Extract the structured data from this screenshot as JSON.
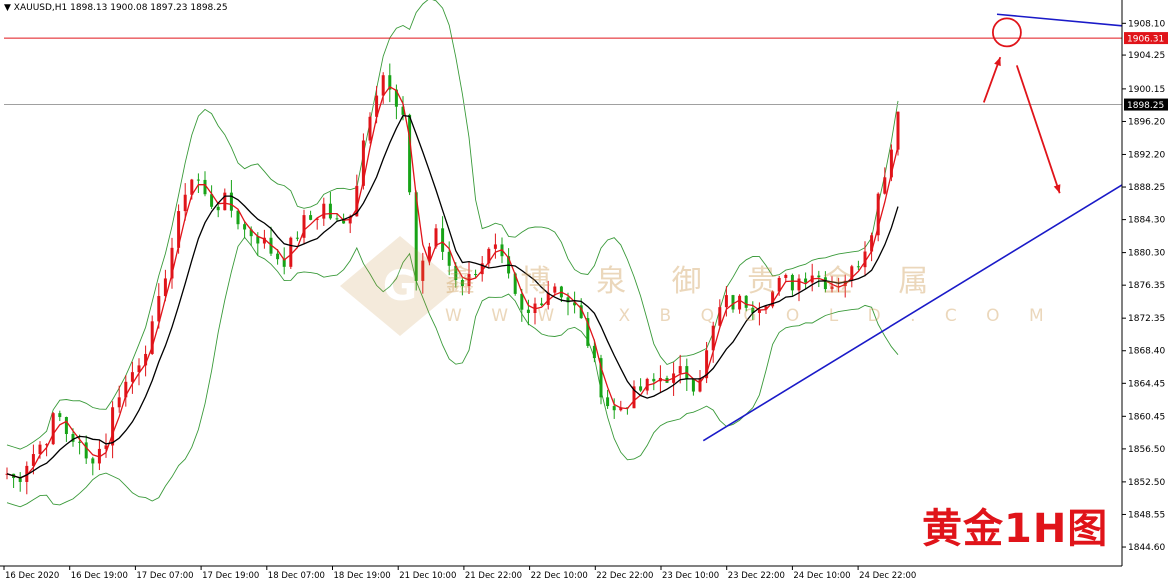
{
  "header": {
    "symbol_line": "▼ XAUUSD,H1  1898.13 1900.08 1897.23 1898.25"
  },
  "overlay_title": "黄金1H图",
  "watermark": {
    "text": "鑫 博 泉  御 贵 金 属",
    "url": "W W W . X B Q G O L D . C O M"
  },
  "colors": {
    "bull": "#e0141a",
    "bear": "#17a317",
    "bands": "#3a9a3a",
    "ma_fast": "#e0141a",
    "ma_slow": "#000000",
    "trendline": "#1a1ac8",
    "resistance": "#e0141a"
  },
  "chart_data": {
    "type": "candlestick",
    "title": "",
    "y_axis_ticks": [
      "1908.10",
      "1904.25",
      "1900.15",
      "1896.20",
      "1892.20",
      "1888.25",
      "1884.30",
      "1880.30",
      "1876.35",
      "1872.35",
      "1868.40",
      "1864.45",
      "1860.45",
      "1856.50",
      "1852.50",
      "1848.55",
      "1844.60"
    ],
    "ylim": [
      1842.3,
      1910.2
    ],
    "x_axis_ticks": [
      "16 Dec 2020",
      "16 Dec 19:00",
      "17 Dec 07:00",
      "17 Dec 19:00",
      "18 Dec 07:00",
      "18 Dec 19:00",
      "21 Dec 10:00",
      "21 Dec 22:00",
      "22 Dec 10:00",
      "22 Dec 22:00",
      "23 Dec 10:00",
      "23 Dec 22:00",
      "24 Dec 10:00",
      "24 Dec 22:00"
    ],
    "price_labels": {
      "resistance": "1906.31",
      "current": "1898.25"
    },
    "resistance_level": 1906.31,
    "current_price": 1898.25,
    "grid": false,
    "candle_count": 160,
    "candle_close_path": [
      [
        0,
        1853.5
      ],
      [
        3,
        1852.5
      ],
      [
        6,
        1855.0
      ],
      [
        9,
        1856.5
      ],
      [
        12,
        1858.0
      ],
      [
        15,
        1861.0
      ],
      [
        18,
        1858.5
      ],
      [
        21,
        1857.5
      ],
      [
        24,
        1855.0
      ],
      [
        27,
        1856.0
      ],
      [
        30,
        1857.5
      ],
      [
        33,
        1863.0
      ],
      [
        36,
        1864.5
      ],
      [
        39,
        1866.5
      ],
      [
        42,
        1869.0
      ],
      [
        45,
        1872.0
      ],
      [
        48,
        1878.0
      ],
      [
        51,
        1882.5
      ],
      [
        54,
        1888.0
      ],
      [
        57,
        1890.0
      ],
      [
        60,
        1887.0
      ],
      [
        63,
        1886.0
      ],
      [
        66,
        1886.5
      ],
      [
        69,
        1885.0
      ],
      [
        72,
        1883.0
      ],
      [
        75,
        1882.5
      ],
      [
        78,
        1881.5
      ],
      [
        81,
        1880.0
      ],
      [
        84,
        1879.5
      ],
      [
        87,
        1882.0
      ],
      [
        90,
        1884.0
      ],
      [
        93,
        1884.5
      ],
      [
        96,
        1886.0
      ],
      [
        99,
        1884.0
      ],
      [
        102,
        1883.5
      ],
      [
        105,
        1886.5
      ],
      [
        108,
        1894.0
      ],
      [
        111,
        1899.5
      ],
      [
        114,
        1902.0
      ],
      [
        117,
        1898.5
      ],
      [
        120,
        1896.0
      ],
      [
        122,
        1888.0
      ],
      [
        124,
        1877.0
      ],
      [
        127,
        1880.5
      ],
      [
        130,
        1882.5
      ],
      [
        133,
        1879.5
      ],
      [
        136,
        1877.5
      ],
      [
        139,
        1876.5
      ],
      [
        142,
        1878.5
      ],
      [
        145,
        1880.0
      ],
      [
        148,
        1880.5
      ],
      [
        151,
        1878.0
      ],
      [
        154,
        1874.5
      ],
      [
        157,
        1872.0
      ],
      [
        160,
        1874.0
      ],
      [
        163,
        1875.5
      ],
      [
        166,
        1876.5
      ],
      [
        169,
        1875.0
      ],
      [
        172,
        1873.5
      ],
      [
        175,
        1871.0
      ],
      [
        178,
        1866.5
      ],
      [
        181,
        1862.5
      ],
      [
        184,
        1861.0
      ],
      [
        187,
        1862.0
      ],
      [
        190,
        1863.0
      ],
      [
        193,
        1864.0
      ],
      [
        196,
        1864.5
      ],
      [
        199,
        1865.5
      ],
      [
        202,
        1865.0
      ],
      [
        205,
        1866.0
      ],
      [
        208,
        1864.5
      ],
      [
        211,
        1866.5
      ],
      [
        214,
        1871.0
      ],
      [
        217,
        1874.5
      ],
      [
        220,
        1874.0
      ],
      [
        223,
        1874.5
      ],
      [
        226,
        1874.0
      ],
      [
        229,
        1874.5
      ],
      [
        232,
        1875.5
      ],
      [
        235,
        1877.0
      ],
      [
        238,
        1876.5
      ],
      [
        241,
        1877.5
      ],
      [
        244,
        1878.0
      ],
      [
        247,
        1877.0
      ],
      [
        250,
        1876.5
      ],
      [
        253,
        1877.0
      ],
      [
        256,
        1878.0
      ],
      [
        259,
        1880.0
      ],
      [
        262,
        1883.5
      ],
      [
        265,
        1889.0
      ],
      [
        268,
        1893.0
      ],
      [
        270,
        1898.25
      ]
    ],
    "candle_index_range": [
      0,
      270
    ],
    "moving_averages": [
      {
        "name": "",
        "color": "red",
        "lag": 3
      },
      {
        "name": "",
        "color": "black",
        "lag": 8
      }
    ],
    "bollinger_bands": {
      "visible": true,
      "width_note": "upper and lower envelopes"
    },
    "annotations": [
      {
        "type": "horizontal_line",
        "price": 1906.31,
        "color": "red"
      },
      {
        "type": "horizontal_line",
        "price": 1898.25,
        "color": "grey"
      },
      {
        "type": "trendline",
        "from": [
          211,
          1857.5
        ],
        "to": [
          362,
          1888.5
        ],
        "color": "blue"
      },
      {
        "type": "trendline",
        "from": [
          300,
          1909.2
        ],
        "to": [
          359,
          1907.8
        ],
        "color": "blue"
      },
      {
        "type": "circle",
        "center": [
          303,
          1907.0
        ],
        "color": "red"
      },
      {
        "type": "arrow",
        "from": [
          296,
          1898.5
        ],
        "to": [
          301,
          1904.0
        ],
        "color": "red"
      },
      {
        "type": "arrow",
        "from": [
          306,
          1903.0
        ],
        "to": [
          319,
          1887.5
        ],
        "color": "red"
      }
    ]
  }
}
